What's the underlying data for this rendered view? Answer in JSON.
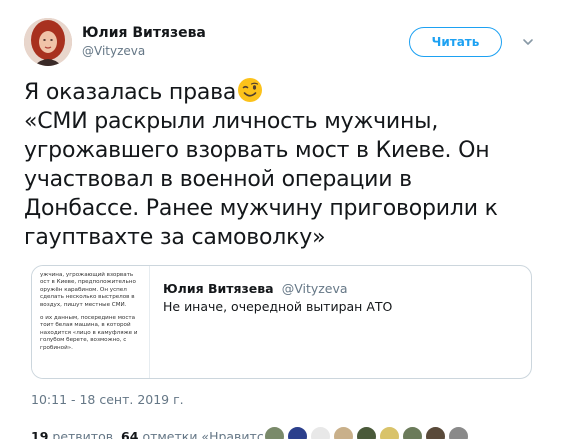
{
  "author": {
    "name": "Юлия Витязева",
    "handle": "@Vityzeva"
  },
  "follow_button": "Читать",
  "tweet": {
    "lines": [
      "Я оказалась права",
      "«СМИ раскрыли личность мужчины,",
      "угрожавшего взорвать мост в Киеве. Он",
      "участвовал в военной операции в",
      "Донбассе. Ранее мужчину приговорили к",
      "гауптвахте за самоволку»"
    ],
    "emoji": "winking-face-emoji"
  },
  "quote": {
    "author_name": "Юлия Витязева",
    "author_handle": "@Vityzeva",
    "text": "Не иначе, очередной вытиран АТО",
    "media_text": [
      [
        "ужчина, угрожающий взорвать",
        "ост в Киеве, предположительно",
        "оружён карабином. Он успел",
        "сделать несколько выстрелов в",
        "воздух, пишут местные СМИ."
      ],
      [
        "о их данным, посередине моста",
        "тоит белая машина, в которой",
        "находится «лицо в камуфляже и",
        "голубом берете, возможно, с",
        "гробиной»."
      ]
    ]
  },
  "timestamp": "10:11 - 18 сент. 2019 г.",
  "stats": {
    "retweets_count": "19",
    "retweets_label": "ретвитов",
    "likes_count": "64",
    "likes_label": "отметки «Нравится»"
  },
  "colors": {
    "accent": "#1da1f2",
    "secondary_text": "#657786",
    "border": "#ccd6dd"
  }
}
